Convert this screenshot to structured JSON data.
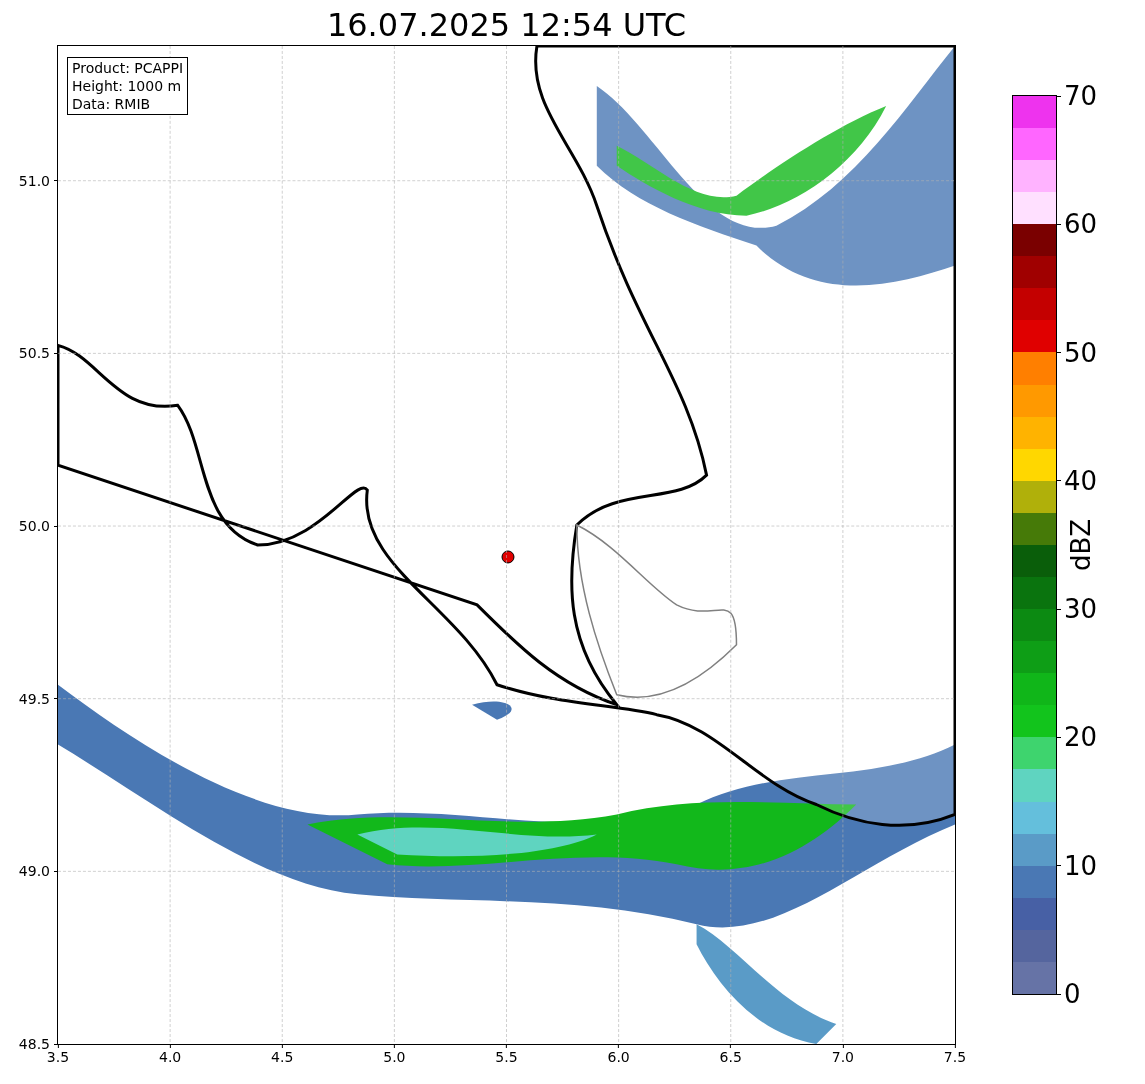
{
  "title": "16.07.2025 12:54 UTC",
  "info_box": [
    "Product: PCAPPI",
    "Height: 1000 m",
    "Data: RMIB"
  ],
  "x_axis": {
    "ticks": [
      "3.5",
      "4.0",
      "4.5",
      "5.0",
      "5.5",
      "6.0",
      "6.5",
      "7.0",
      "7.5"
    ]
  },
  "y_axis": {
    "ticks": [
      "51.0",
      "50.5",
      "50.0",
      "49.5",
      "49.0",
      "48.5"
    ]
  },
  "colorbar": {
    "label": "dBZ",
    "ticks": [
      "70",
      "60",
      "50",
      "40",
      "30",
      "20",
      "10",
      "0"
    ],
    "segments": [
      {
        "color": "#6673a6"
      },
      {
        "color": "#55659e"
      },
      {
        "color": "#4760a5"
      },
      {
        "color": "#4a78b4"
      },
      {
        "color": "#5a9bc7"
      },
      {
        "color": "#64bfdc"
      },
      {
        "color": "#5fd4c0"
      },
      {
        "color": "#3ed46e"
      },
      {
        "color": "#12c41c"
      },
      {
        "color": "#10b619"
      },
      {
        "color": "#0e9e16"
      },
      {
        "color": "#0c8a12"
      },
      {
        "color": "#0a740e"
      },
      {
        "color": "#0a5e0a"
      },
      {
        "color": "#467a08"
      },
      {
        "color": "#b0b00a"
      },
      {
        "color": "#ffd700"
      },
      {
        "color": "#ffb300"
      },
      {
        "color": "#ff9900"
      },
      {
        "color": "#ff7f00"
      },
      {
        "color": "#e00000"
      },
      {
        "color": "#c40000"
      },
      {
        "color": "#a00000"
      },
      {
        "color": "#7a0000"
      },
      {
        "color": "#ffe0ff"
      },
      {
        "color": "#ffb3ff"
      },
      {
        "color": "#ff66ff"
      },
      {
        "color": "#ee33ee"
      }
    ]
  }
}
